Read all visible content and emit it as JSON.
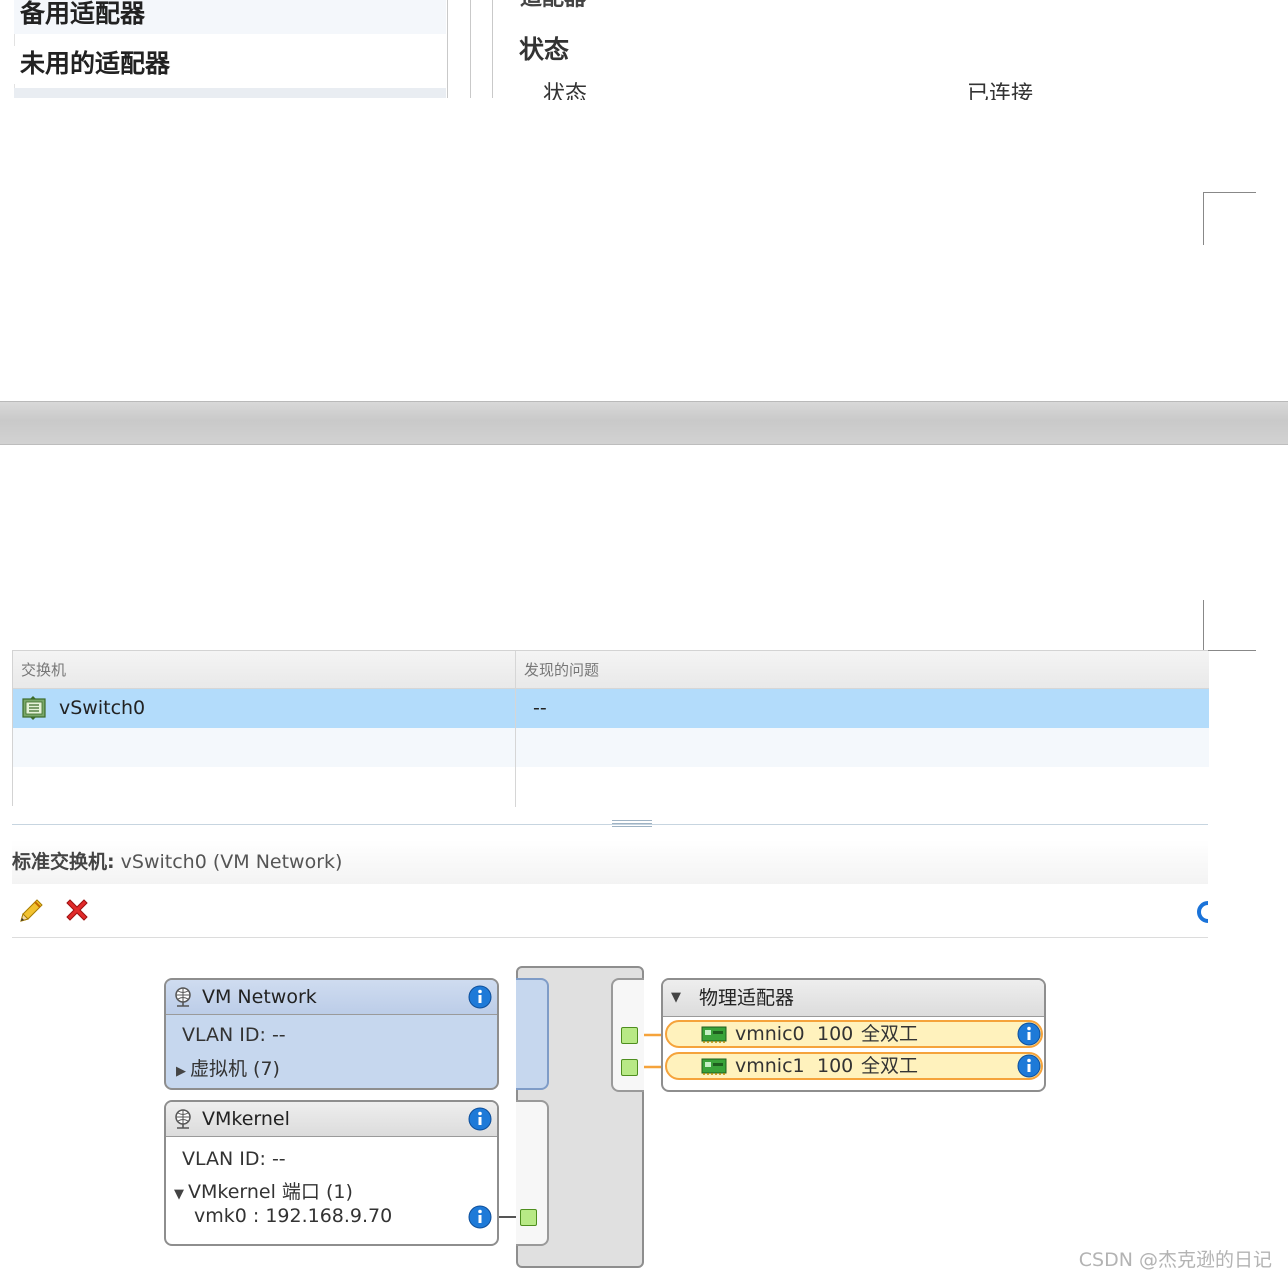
{
  "top_fragment": {
    "sidebar_items": [
      "备用适配器",
      "未用的适配器"
    ],
    "partial_heading": "适配器",
    "section_heading": "状态",
    "status_label": "状态",
    "status_value": "已连接"
  },
  "switch_table": {
    "columns": [
      "交换机",
      "发现的问题"
    ],
    "rows": [
      {
        "switch": "vSwitch0",
        "issues": "--"
      }
    ]
  },
  "detail": {
    "title_prefix": "标准交换机:",
    "title_rest": "vSwitch0 (VM Network)"
  },
  "topology": {
    "port_groups": [
      {
        "name": "VM Network",
        "vlan": "VLAN ID: --",
        "child": "虚拟机 (7)",
        "expand_icon": "triangle-right"
      },
      {
        "name": "VMkernel",
        "vlan": "VLAN ID: --",
        "child": "VMkernel 端口 (1)",
        "port": "vmk0 : 192.168.9.70",
        "expand_icon": "triangle-down"
      }
    ],
    "physical": {
      "header": "物理适配器",
      "adapters": [
        {
          "name": "vmnic0",
          "speed": "100",
          "duplex": "全双工"
        },
        {
          "name": "vmnic1",
          "speed": "100",
          "duplex": "全双工"
        }
      ]
    }
  },
  "watermark": "CSDN @杰克逊的日记",
  "colors": {
    "selected_row": "#b3dcfb",
    "portgroup_blue": "#c6d7ee",
    "link_orange": "#f5a33b",
    "port_green": "#b8e986"
  }
}
